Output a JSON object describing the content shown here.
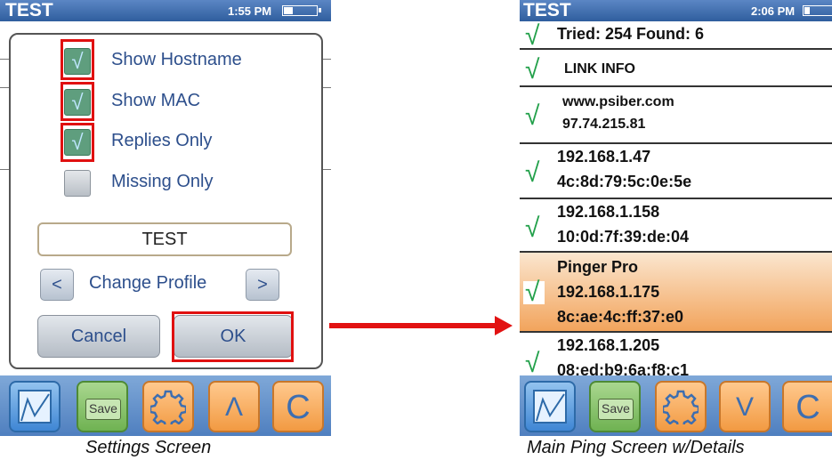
{
  "settings_screen": {
    "title": "TEST",
    "time": "1:55 PM",
    "options": [
      {
        "label": "Show Hostname",
        "checked": true
      },
      {
        "label": "Show MAC",
        "checked": true
      },
      {
        "label": "Replies Only",
        "checked": true
      },
      {
        "label": "Missing Only",
        "checked": false
      }
    ],
    "check_glyph": "√",
    "profile_name": "TEST",
    "prev_label": "<",
    "change_profile_label": "Change Profile",
    "next_label": ">",
    "cancel_label": "Cancel",
    "ok_label": "OK",
    "caption": "Settings Screen",
    "toolbar": {
      "graph_icon": "graph-icon",
      "save_label": "Save",
      "settings_icon": "gear-icon",
      "up_label": "Λ",
      "refresh_label": "C"
    }
  },
  "main_screen": {
    "title": "TEST",
    "time": "2:06 PM",
    "check_glyph": "√",
    "rows": [
      {
        "lines": [
          "Tried: 254 Found: 6"
        ]
      },
      {
        "lines": [
          "LINK INFO"
        ]
      },
      {
        "lines": [
          "www.psiber.com",
          "97.74.215.81"
        ]
      },
      {
        "lines": [
          "192.168.1.47",
          "4c:8d:79:5c:0e:5e"
        ]
      },
      {
        "lines": [
          "192.168.1.158",
          "10:0d:7f:39:de:04"
        ]
      },
      {
        "lines": [
          "Pinger Pro",
          "192.168.1.175",
          "8c:ae:4c:ff:37:e0"
        ],
        "selected": true
      },
      {
        "lines": [
          "192.168.1.205",
          "08:ed:b9:6a:f8:c1"
        ]
      }
    ],
    "caption": "Main Ping Screen w/Details",
    "toolbar": {
      "graph_icon": "graph-icon",
      "save_label": "Save",
      "settings_icon": "gear-icon",
      "down_label": "V",
      "refresh_label": "C"
    }
  },
  "colors": {
    "highlight_red": "#e01010",
    "status_bar_blue": "#2f5e9e",
    "label_blue": "#2d4f8c",
    "check_green": "#22a04a",
    "selected_row_orange": "#f2a45c"
  },
  "battery_level_left": 0.25,
  "battery_level_right": 0.15
}
